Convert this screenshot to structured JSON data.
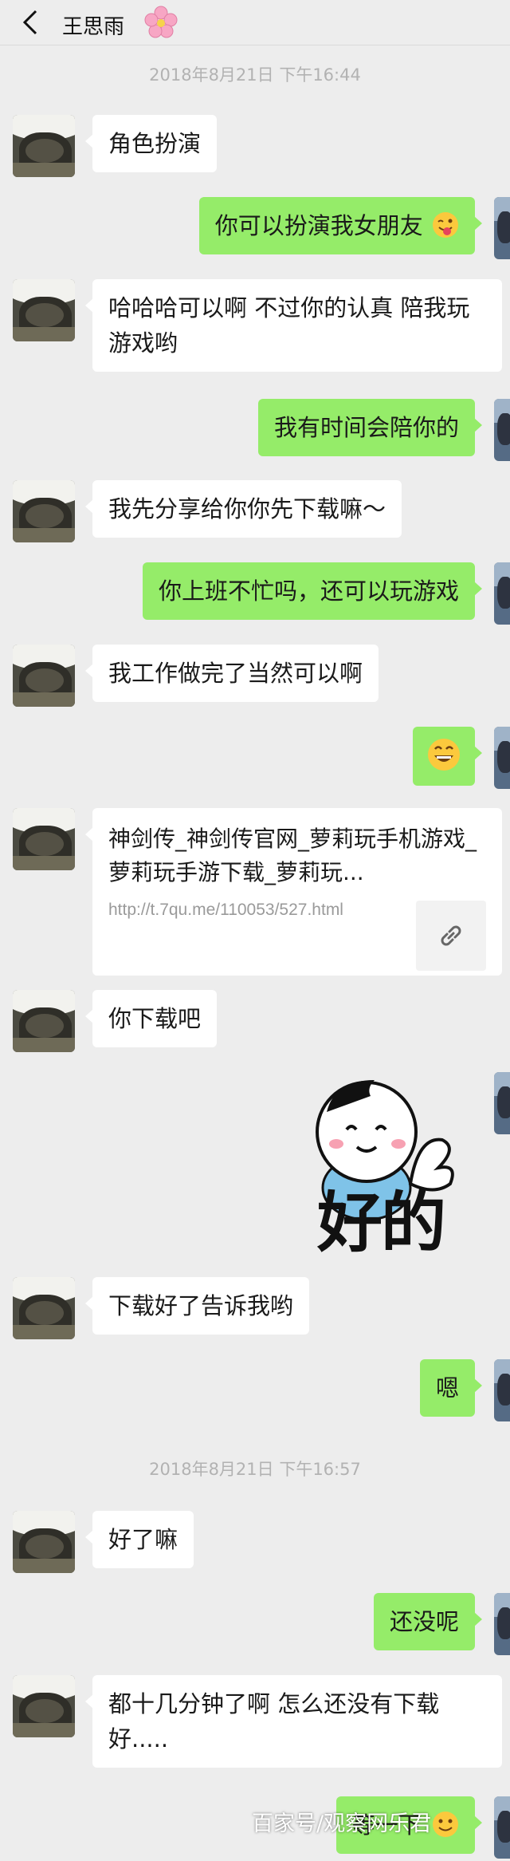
{
  "header": {
    "back_icon": "chevron-left-icon",
    "title": "王思雨",
    "title_emoji": "cherry-blossom-icon"
  },
  "timestamps": [
    "2018年8月21日 下午16:44",
    "2018年8月21日 下午16:57"
  ],
  "messages": [
    {
      "side": "left",
      "text": "角色扮演"
    },
    {
      "side": "right",
      "text": "你可以扮演我女朋友"
    },
    {
      "side": "left",
      "text": "哈哈哈可以啊   不过你的认真 陪我玩游戏哟"
    },
    {
      "side": "right",
      "text": "我有时间会陪你的"
    },
    {
      "side": "left",
      "text": "我先分享给你你先下载嘛～"
    },
    {
      "side": "right",
      "text": "你上班不忙吗，还可以玩游戏"
    },
    {
      "side": "left",
      "text": "我工作做完了当然可以啊"
    },
    {
      "side": "right",
      "text": "",
      "emoji": "grinning-face-icon"
    },
    {
      "side": "left",
      "type": "link",
      "title": "神剑传_神剑传官网_萝莉玩手机游戏_萝莉玩手游下载_萝莉玩...",
      "url": "http://t.7qu.me/110053/527.html"
    },
    {
      "side": "left",
      "text": "你下载吧"
    },
    {
      "side": "right",
      "type": "sticker",
      "sticker_text": "好的"
    },
    {
      "side": "left",
      "text": "下载好了告诉我哟"
    },
    {
      "side": "right",
      "text": "嗯"
    },
    {
      "side": "left",
      "text": "好了嘛"
    },
    {
      "side": "right",
      "text": "还没呢"
    },
    {
      "side": "left",
      "text": "都十几分钟了啊 怎么还没有下载好....."
    },
    {
      "side": "right",
      "text": "等一下",
      "emoji": "face-icon"
    }
  ],
  "watermark": "百家号/观察网乐君"
}
